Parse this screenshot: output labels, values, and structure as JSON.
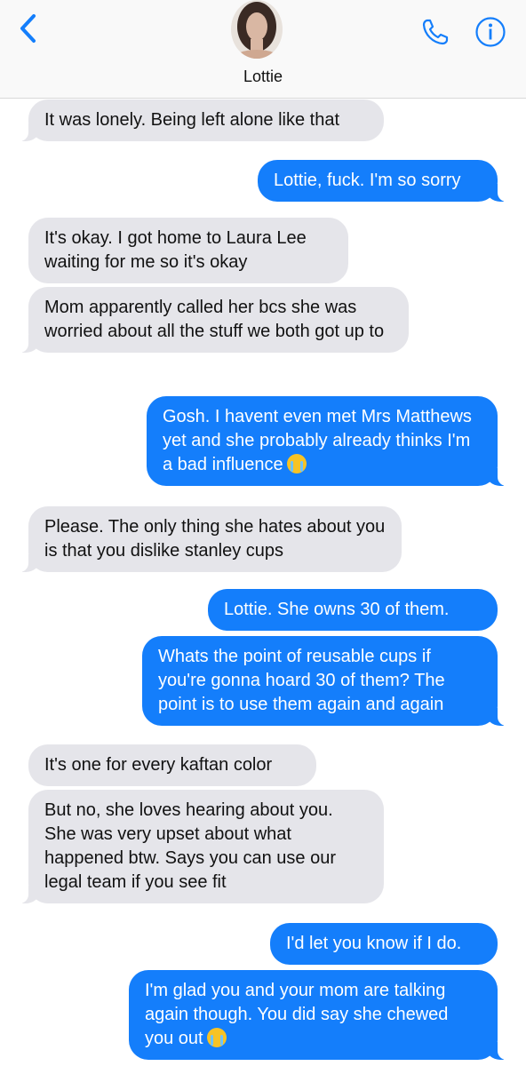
{
  "header": {
    "contact_name": "Lottie",
    "back_icon": "chevron-left-icon",
    "call_icon": "phone-icon",
    "info_icon": "info-icon",
    "accent_color": "#147efb"
  },
  "messages": [
    {
      "from": "them",
      "text": "It was lonely. Being left alone like that"
    },
    {
      "from": "me",
      "text": "Lottie, fuck. I'm so sorry"
    },
    {
      "from": "them",
      "text": "It's okay. I got home to Laura Lee waiting for me so it's okay"
    },
    {
      "from": "them",
      "text": "Mom apparently called her bcs she was worried about all the stuff we both got up to"
    },
    {
      "from": "me",
      "text": "Gosh. I havent even met Mrs Matthews yet and she probably already thinks I'm a bad influence",
      "emoji": "loudly-crying-face-emoji"
    },
    {
      "from": "them",
      "text": "Please. The only thing she hates about you is that you dislike stanley cups"
    },
    {
      "from": "me",
      "text": "Lottie. She owns 30 of them."
    },
    {
      "from": "me",
      "text": "Whats the point of reusable cups if you're gonna hoard 30 of them? The point is to use them again and again"
    },
    {
      "from": "them",
      "text": "It's one for every kaftan color"
    },
    {
      "from": "them",
      "text": "But no, she loves hearing about you. She was very upset about what happened btw. Says you can use our legal team if you see fit"
    },
    {
      "from": "me",
      "text": "I'd let you know if I do."
    },
    {
      "from": "me",
      "text": "I'm glad you and your mom are talking again though. You did say she chewed you out",
      "emoji": "loudly-crying-face-emoji"
    }
  ]
}
